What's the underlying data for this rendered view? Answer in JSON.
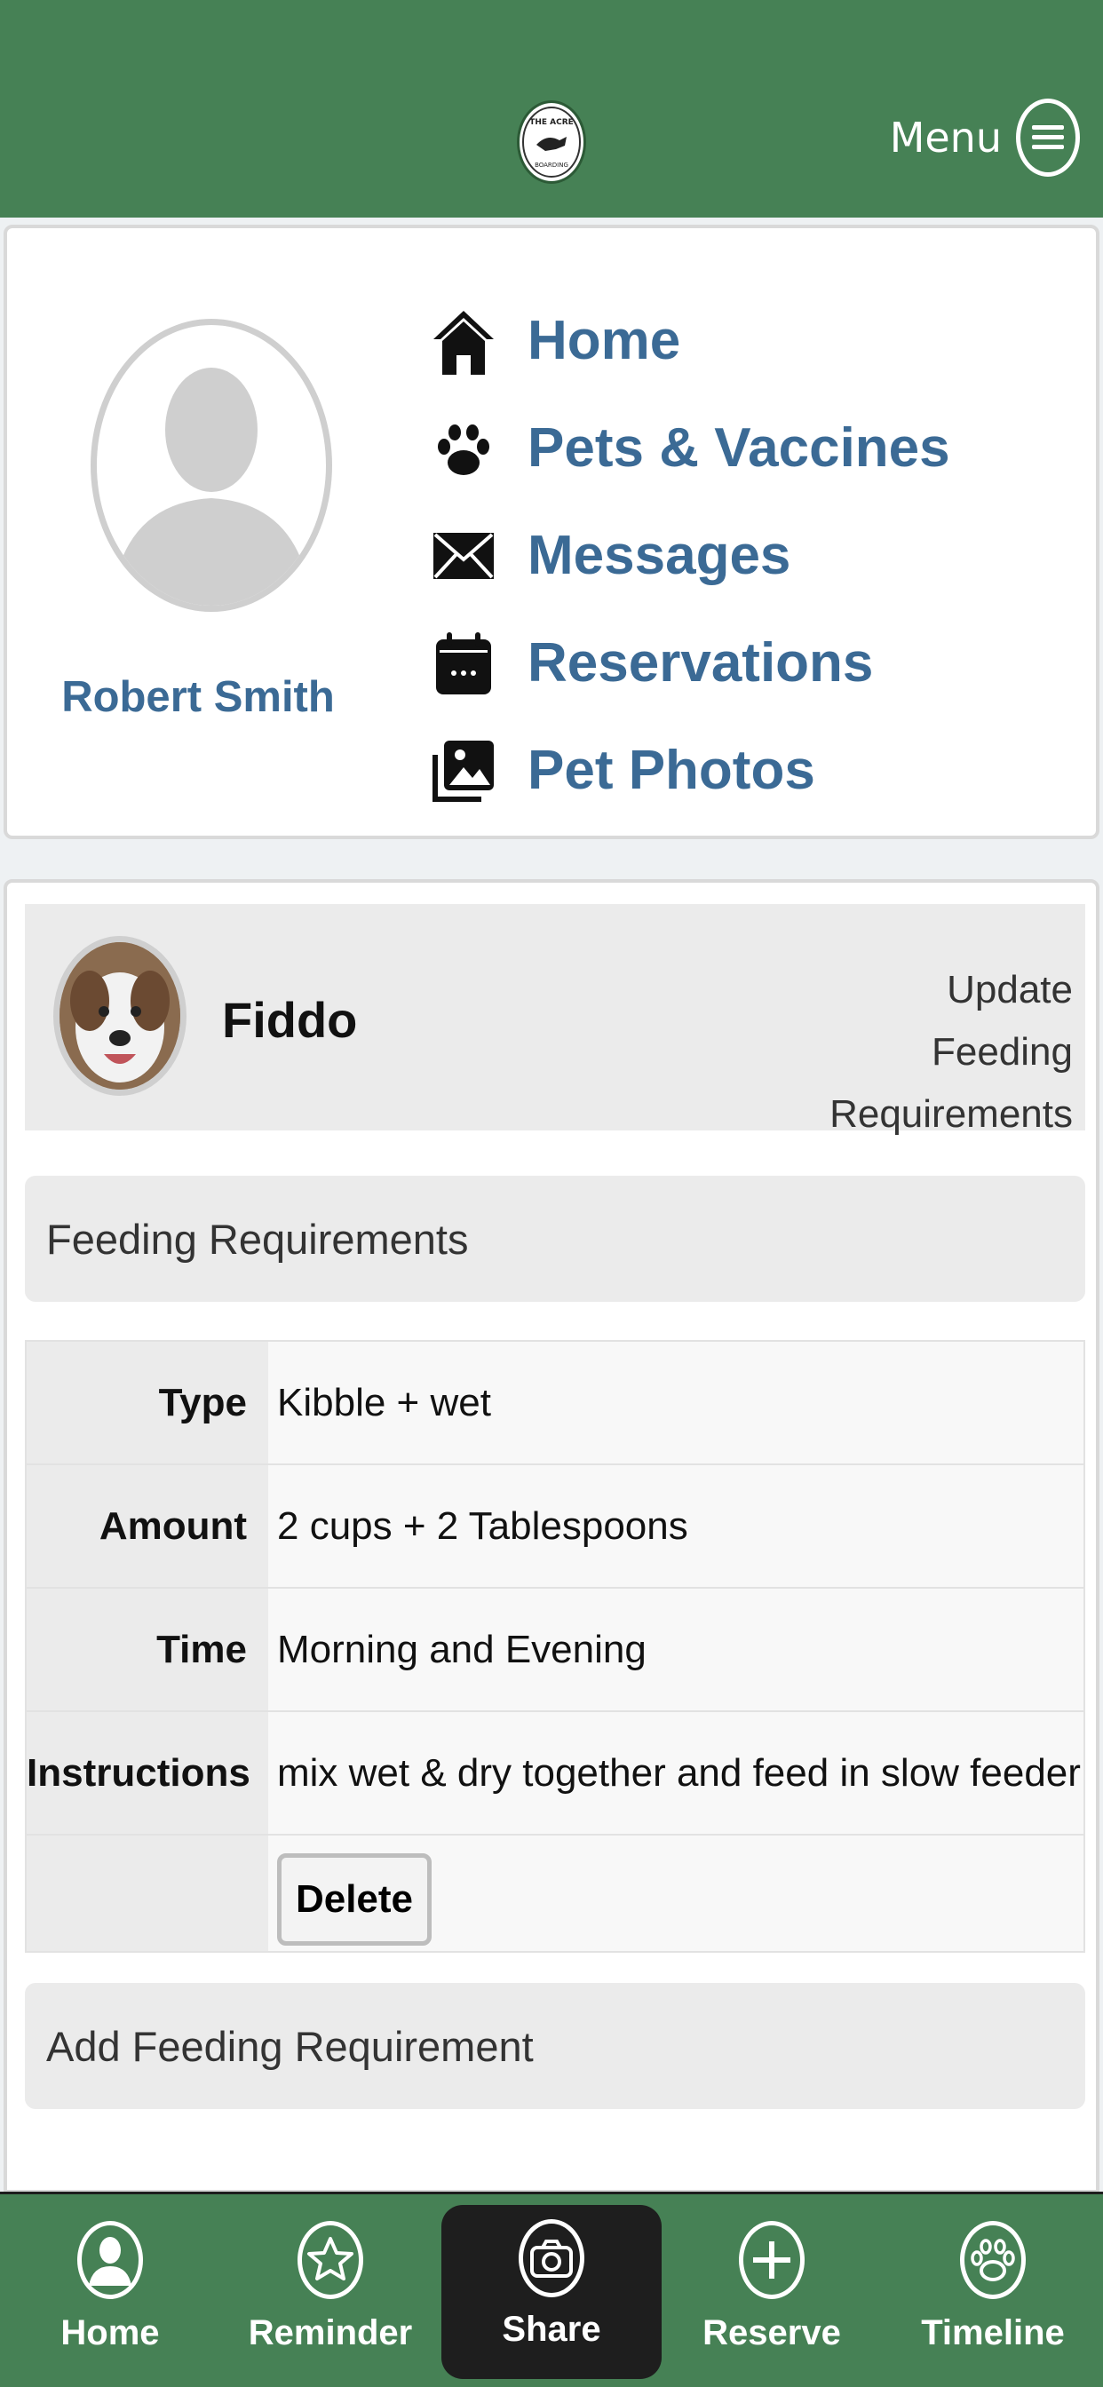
{
  "header": {
    "logo_text": "THE ACRE DAY CARE & DOG BOARDING",
    "menu_label": "Menu"
  },
  "profile": {
    "user_name": "Robert Smith",
    "nav": [
      {
        "label": "Home",
        "icon": "home-icon"
      },
      {
        "label": "Pets & Vaccines",
        "icon": "paw-icon"
      },
      {
        "label": "Messages",
        "icon": "envelope-icon"
      },
      {
        "label": "Reservations",
        "icon": "calendar-icon"
      },
      {
        "label": "Pet Photos",
        "icon": "photos-icon"
      }
    ]
  },
  "pet": {
    "name": "Fiddo",
    "update_link": "Update Feeding Requirements",
    "update_link_line1": "Update Feeding",
    "update_link_line2": "Requirements"
  },
  "feeding": {
    "section_title": "Feeding Requirements",
    "rows": [
      {
        "label": "Type",
        "value": "Kibble + wet"
      },
      {
        "label": "Amount",
        "value": "2 cups + 2 Tablespoons"
      },
      {
        "label": "Time",
        "value": "Morning and Evening"
      },
      {
        "label": "Instructions",
        "value": "mix wet & dry together and feed in slow feeder"
      }
    ],
    "delete_label": "Delete",
    "add_label": "Add Feeding Requirement"
  },
  "tabbar": {
    "tabs": [
      {
        "label": "Home",
        "icon": "user-icon"
      },
      {
        "label": "Reminder",
        "icon": "star-icon"
      },
      {
        "label": "Share",
        "icon": "camera-icon",
        "active": true
      },
      {
        "label": "Reserve",
        "icon": "plus-icon"
      },
      {
        "label": "Timeline",
        "icon": "paw-icon"
      }
    ]
  },
  "colors": {
    "brand_green": "#468155",
    "link_blue": "#3b6a95",
    "active_tab": "#1e1e1e"
  }
}
